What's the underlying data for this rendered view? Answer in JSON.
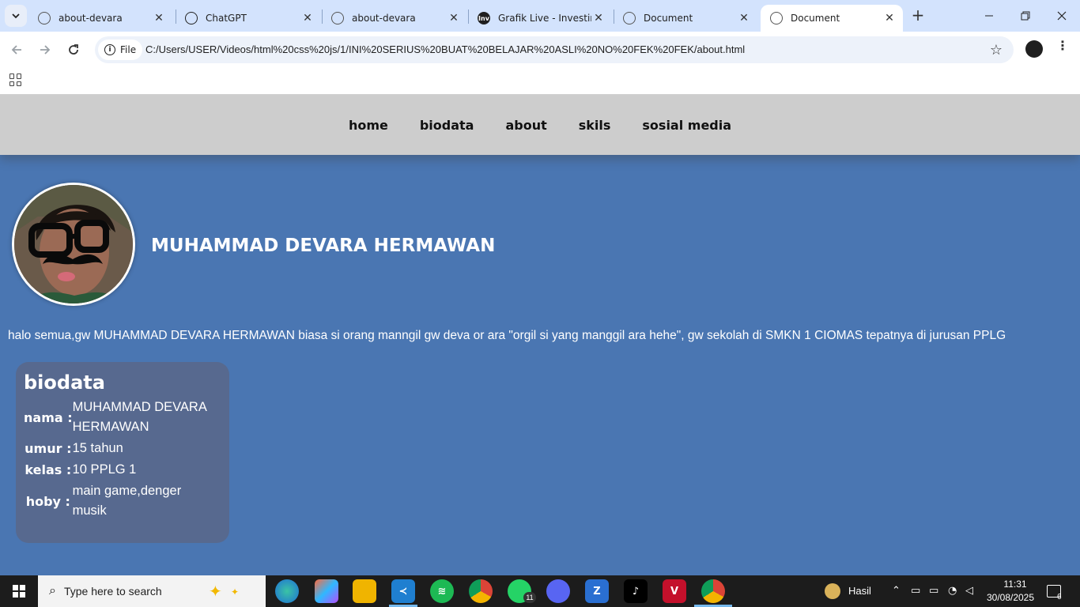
{
  "browser": {
    "tabs": [
      {
        "title": "about-devara",
        "icon": "globe-icon",
        "active": false
      },
      {
        "title": "ChatGPT",
        "icon": "chatgpt-icon",
        "active": false
      },
      {
        "title": "about-devara",
        "icon": "globe-icon",
        "active": false
      },
      {
        "title": "Grafik Live - Investing",
        "icon": "investing-icon",
        "active": false
      },
      {
        "title": "Document",
        "icon": "globe-icon",
        "active": false
      },
      {
        "title": "Document",
        "icon": "globe-icon",
        "active": true
      }
    ],
    "investing_icon_text": "Inv",
    "site_chip": "File",
    "url": "C:/Users/USER/Videos/html%20css%20js/1/INI%20SERIUS%20BUAT%20BELAJAR%20ASLI%20NO%20FEK%20FEK/about.html"
  },
  "site": {
    "nav": [
      "home",
      "biodata",
      "about",
      "skils",
      "sosial media"
    ],
    "name": "MUHAMMAD DEVARA HERMAWAN",
    "intro": "halo semua,gw MUHAMMAD DEVARA HERMAWAN biasa si orang manngil gw deva or ara \"orgil si yang manggil ara hehe\", gw sekolah di SMKN 1 CIOMAS tepatnya di jurusan PPLG",
    "biodata": {
      "heading": "biodata",
      "rows": [
        {
          "key": "nama :",
          "value": "MUHAMMAD DEVARA HERMAWAN"
        },
        {
          "key": "umur :",
          "value": "15 tahun"
        },
        {
          "key": "kelas :",
          "value": "10 PPLG 1"
        },
        {
          "key": "hoby :",
          "value": "main game,denger musik"
        }
      ]
    }
  },
  "taskbar": {
    "search_placeholder": "Type here to search",
    "whatsapp_badge": "11",
    "weather_label": "Hasil",
    "time": "11:31",
    "date": "30/08/2025",
    "notification_count": "6"
  },
  "colors": {
    "page_bg": "#4a76b2",
    "nav_bg": "#cdcdcd",
    "card_bg": "#57698f",
    "tabstrip_bg": "#d3e3fd"
  }
}
